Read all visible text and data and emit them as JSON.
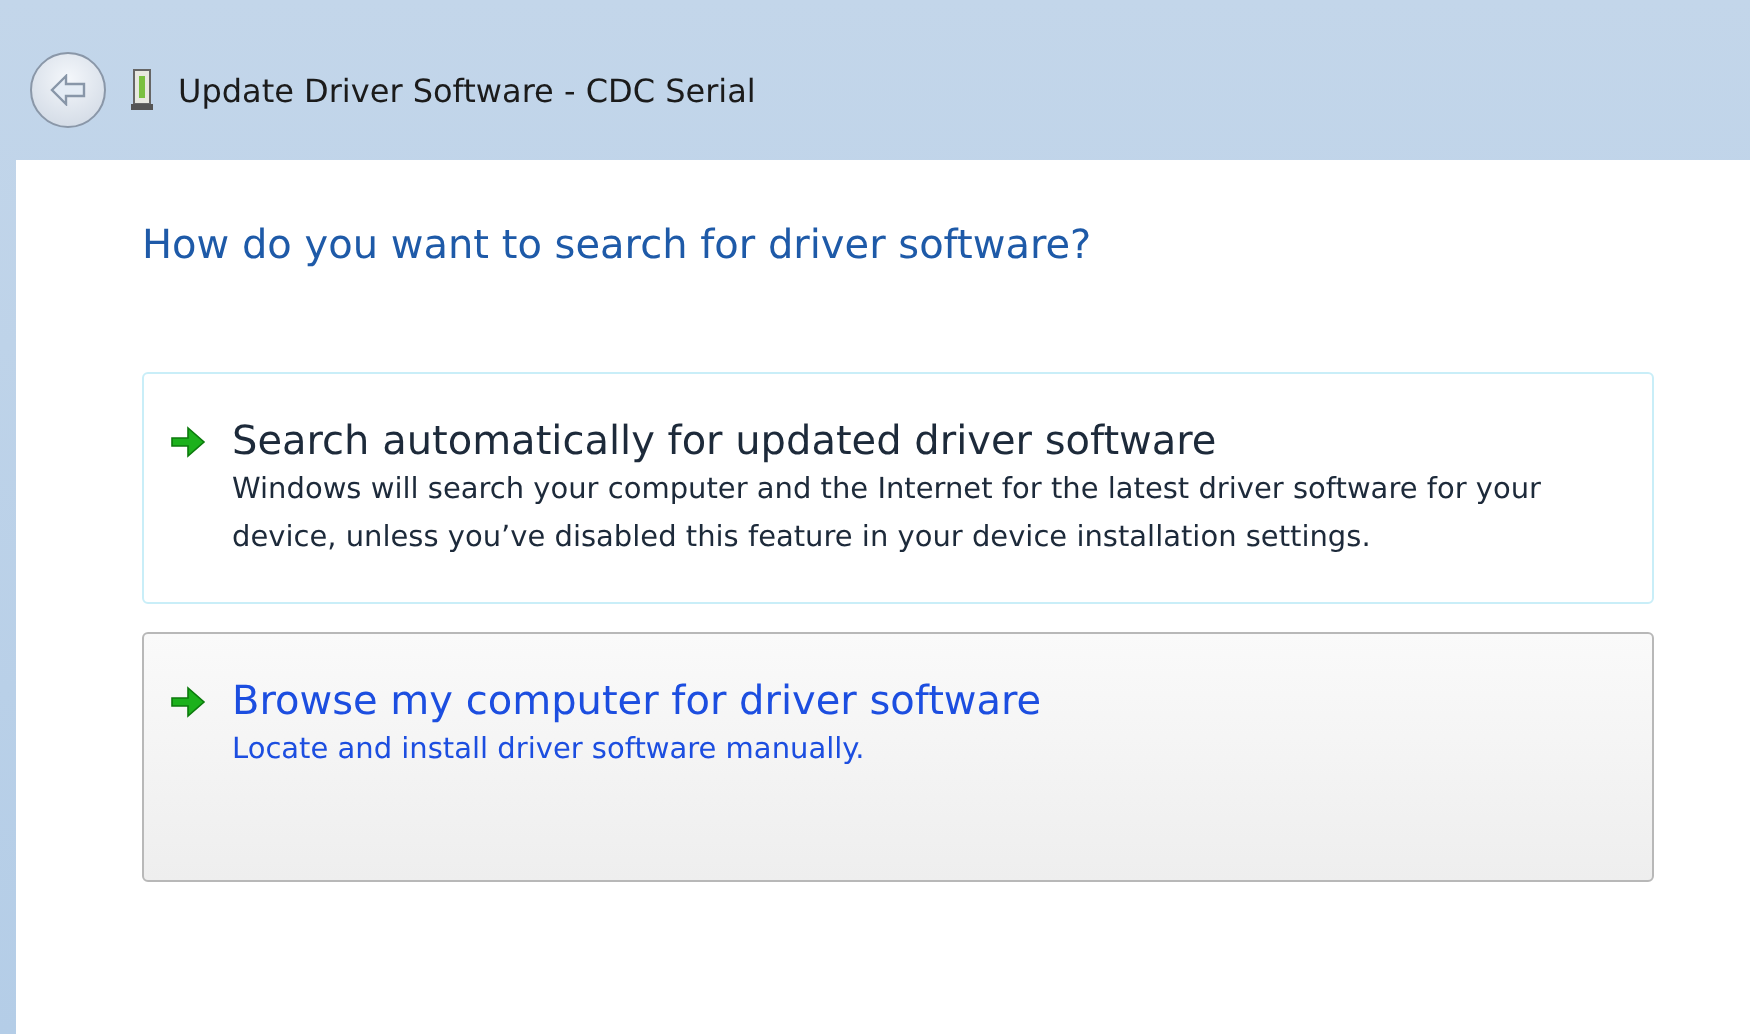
{
  "window": {
    "title": "Update Driver Software - CDC Serial"
  },
  "heading": "How do you want to search for driver software?",
  "options": [
    {
      "title": "Search automatically for updated driver software",
      "description": "Windows will search your computer and the Internet for the latest driver software for your device, unless you’ve disabled this feature in your device installation settings.",
      "selected": false
    },
    {
      "title": "Browse my computer for driver software",
      "description": "Locate and install driver software manually.",
      "selected": true
    }
  ]
}
